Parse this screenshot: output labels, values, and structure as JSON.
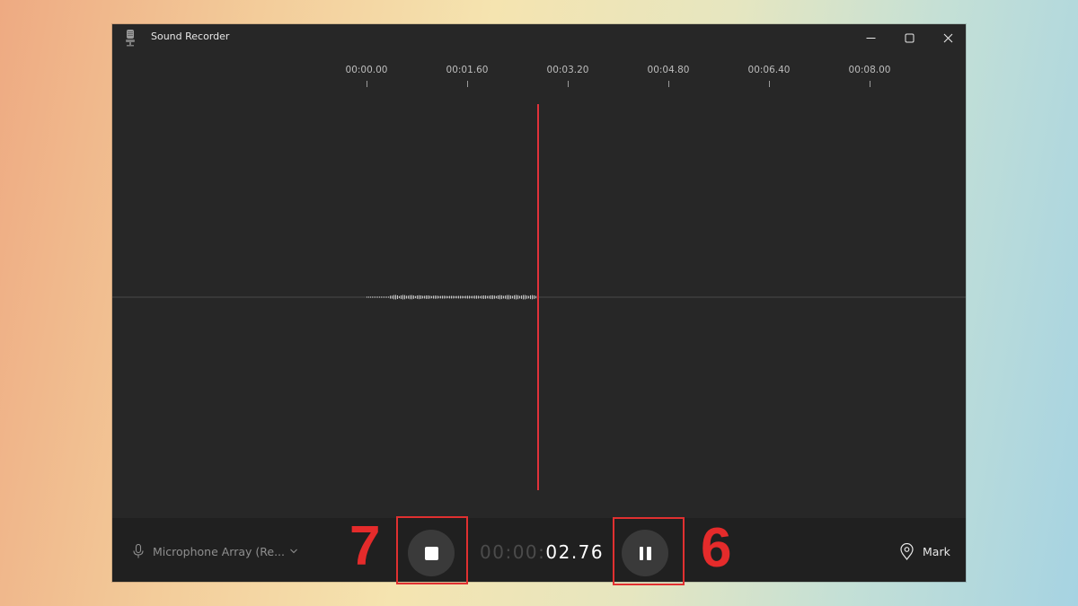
{
  "window": {
    "title": "Sound Recorder",
    "icon": "microphone-app-icon",
    "controls": [
      "minimize-icon",
      "maximize-icon",
      "close-icon"
    ]
  },
  "timeline": {
    "ticks": [
      "00:00.00",
      "00:01.60",
      "00:03.20",
      "00:04.80",
      "00:06.40",
      "00:08.00"
    ]
  },
  "recording": {
    "elapsed_dim": "00:00:",
    "elapsed_value": "02.76",
    "playhead_color": "#e0323a"
  },
  "bottom_bar": {
    "mic_label": "Microphone Array (Re...",
    "mark_label": "Mark"
  },
  "annotations": {
    "stop_label": "7",
    "pause_label": "6",
    "color": "#e52b2b"
  },
  "colors": {
    "window_bg": "#272727",
    "bottom_bar_bg": "#202020",
    "button_bg": "#3a3a3a"
  }
}
